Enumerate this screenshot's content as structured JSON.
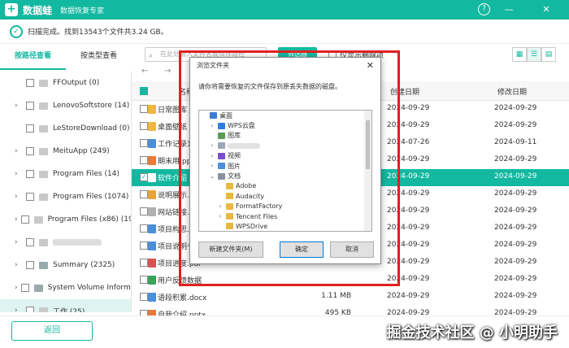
{
  "app": {
    "name": "数据蛙",
    "subtitle": "数据恢复专家",
    "logo_char": "+"
  },
  "window_controls": {
    "help": "?",
    "minimize": "—",
    "close": "✕"
  },
  "scan": {
    "status": "扫描完成。找到13543个文件共3.24 GB。"
  },
  "left_tabs": [
    {
      "label": "按路径查看"
    },
    {
      "label": "按类型查看"
    }
  ],
  "sidebar": {
    "items": [
      {
        "label": "FFOutput (0)",
        "has_arrow": false
      },
      {
        "label": "LenovoSoftstore (14)",
        "has_arrow": true
      },
      {
        "label": "LeStoreDownload (0)",
        "has_arrow": false
      },
      {
        "label": "MeituApp (249)",
        "has_arrow": true
      },
      {
        "label": "Program Files (14)",
        "has_arrow": true
      },
      {
        "label": "Program Files (1074)",
        "has_arrow": true
      },
      {
        "label": "Program Files (x86) (1976",
        "has_arrow": true
      },
      {
        "label": "",
        "has_arrow": true,
        "blurred": true
      },
      {
        "label": "Summary (2325)",
        "has_arrow": true
      },
      {
        "label": "System Volume Informati",
        "has_arrow": true
      },
      {
        "label": "工作 (25)",
        "has_arrow": true
      }
    ]
  },
  "toolbar": {
    "search_placeholder": "在此处输入文件名或保存路径",
    "filter_label": "筛选器",
    "only_deleted_label": "仅显示删除项"
  },
  "table": {
    "headers": {
      "name": "名称",
      "size": "",
      "created": "创建日期",
      "modified": "修改日期"
    },
    "rows": [
      {
        "name": "日常图库",
        "size": "",
        "created": "2024-09-29",
        "modified": "2024-09-29",
        "icon": "#f0b840"
      },
      {
        "name": "桌面壁纸",
        "size": "",
        "created": "2024-09-29",
        "modified": "2024-09-29",
        "icon": "#f0b840"
      },
      {
        "name": "工作记录1",
        "size": "",
        "created": "2024-07-26",
        "modified": "2024-09-11",
        "icon": "#4a90d9"
      },
      {
        "name": "期末用.ppt",
        "size": "",
        "created": "2024-09-29",
        "modified": "2024-09-29",
        "icon": "#e87b3a"
      },
      {
        "name": "软件介绍",
        "size": "",
        "created": "2024-09-29",
        "modified": "2024-09-29",
        "icon": "#ffffff",
        "selected": true
      },
      {
        "name": "说明展示.pdf",
        "size": "",
        "created": "2024-09-29",
        "modified": "2024-09-29",
        "icon": "#e8a33a"
      },
      {
        "name": "网站链接.txt",
        "size": "",
        "created": "2024-09-29",
        "modified": "2024-09-29",
        "icon": "#b0b0b0"
      },
      {
        "name": "项目构思.docx",
        "size": "",
        "created": "2024-09-29",
        "modified": "2024-09-29",
        "icon": "#4a90d9"
      },
      {
        "name": "项目说明书",
        "size": "",
        "created": "2024-09-29",
        "modified": "2024-09-29",
        "icon": "#4a90d9"
      },
      {
        "name": "项目进度.pdf",
        "size": "",
        "created": "2024-09-29",
        "modified": "2024-09-29",
        "icon": "#d9534f"
      },
      {
        "name": "用户反馈数据",
        "size": "",
        "created": "2024-09-29",
        "modified": "2024-09-29",
        "icon": "#3aa35a"
      },
      {
        "name": "语段积累.docx",
        "size": "1.11 MB",
        "created": "2024-09-29",
        "modified": "2024-09-29",
        "icon": "#4a90d9"
      },
      {
        "name": "自我介绍.pptx",
        "size": "495 KB",
        "created": "2024-09-29",
        "modified": "2024-09-29",
        "icon": "#e87b3a"
      },
      {
        "name": "自我介绍.txt",
        "size": "691 B",
        "created": "2024-09-29",
        "modified": "2024-09-29",
        "icon": "#b0b0b0"
      }
    ]
  },
  "dialog": {
    "title": "浏览文件夹",
    "prompt": "请你将需要恢复的文件保存到原丢失数据的磁盘。",
    "tree": [
      {
        "label": "桌面",
        "indent": 0,
        "arrow": "",
        "icon": "#3a7bd5"
      },
      {
        "label": "WPS云盘",
        "indent": 1,
        "arrow": "›",
        "icon": "#2f7fe0"
      },
      {
        "label": "图库",
        "indent": 1,
        "arrow": "",
        "icon": "#5a9a5a"
      },
      {
        "label": "",
        "indent": 1,
        "arrow": "›",
        "icon": "#9aa8b8",
        "blurred": true
      },
      {
        "label": "视频",
        "indent": 1,
        "arrow": "›",
        "icon": "#7a4fc9"
      },
      {
        "label": "图片",
        "indent": 1,
        "arrow": "›",
        "icon": "#4a8fd9"
      },
      {
        "label": "文档",
        "indent": 1,
        "arrow": "⌄",
        "icon": "#8a8fa0"
      },
      {
        "label": "Adobe",
        "indent": 2,
        "arrow": "",
        "icon": "#e8b940"
      },
      {
        "label": "Audacity",
        "indent": 2,
        "arrow": "",
        "icon": "#e8b940"
      },
      {
        "label": "FormatFactory",
        "indent": 2,
        "arrow": "›",
        "icon": "#e8b940"
      },
      {
        "label": "Tencent Files",
        "indent": 2,
        "arrow": "›",
        "icon": "#e8b940"
      },
      {
        "label": "WPSDrive",
        "indent": 2,
        "arrow": "",
        "icon": "#e8b940"
      }
    ],
    "new_folder_label": "新建文件夹(M)",
    "ok_label": "确定",
    "cancel_label": "取消"
  },
  "bottom": {
    "back_label": "返回"
  },
  "watermark": "掘金技术社区 @ 小明助手",
  "colors": {
    "accent": "#13b8a0",
    "highlight_box": "#e02020"
  }
}
